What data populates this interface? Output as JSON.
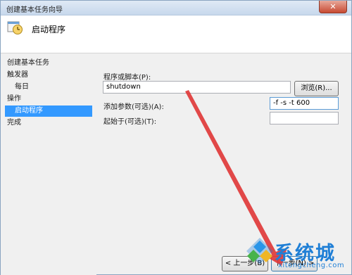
{
  "window": {
    "title": "创建基本任务向导",
    "close_glyph": "✕"
  },
  "header": {
    "heading": "启动程序",
    "icon": "task-clock-icon"
  },
  "sidebar": {
    "items": [
      {
        "label": "创建基本任务"
      },
      {
        "label": "触发器"
      },
      {
        "label": "每日"
      },
      {
        "label": "操作"
      },
      {
        "label": "启动程序"
      },
      {
        "label": "完成"
      }
    ],
    "selected": "启动程序"
  },
  "form": {
    "program_label": "程序或脚本(P):",
    "program_value": "shutdown",
    "browse_label": "浏览(R)...",
    "args_label": "添加参数(可选)(A):",
    "args_value": "-f -s -t 600",
    "startin_label": "起始于(可选)(T):",
    "startin_value": ""
  },
  "footer": {
    "back_label": "< 上一步(B)",
    "next_label": "下一步(N) >"
  },
  "annotation": {
    "arrow_color": "#e03a3a"
  },
  "watermark": {
    "name": "系统城",
    "url": "xitongcheng.com"
  }
}
